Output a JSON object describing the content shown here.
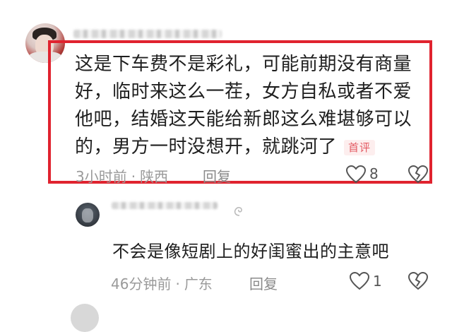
{
  "comment": {
    "lines": [
      "这是下车费不是彩礼，可能前期没有商量",
      "好，临时来这么一茬，女方自私或者不爱",
      "他吧，结婚这天能给新郎这么难堪够可以",
      "的，男方一时没想开，就跳河了"
    ],
    "badge": "首评",
    "time": "3小时前",
    "location": "陕西",
    "separator": "·",
    "reply_label": "回复",
    "like_count": "8"
  },
  "reply": {
    "text": "不会是像短剧上的好闺蜜出的主意吧",
    "time": "46分钟前",
    "location": "广东",
    "separator": "·",
    "reply_label": "回复",
    "like_count": "1"
  },
  "colors": {
    "highlight": "#e0232f",
    "badge_text": "#e35a63",
    "meta_text": "#9a9a9a"
  },
  "icons": {
    "like": "heart-outline-icon",
    "dislike": "broken-heart-icon"
  }
}
